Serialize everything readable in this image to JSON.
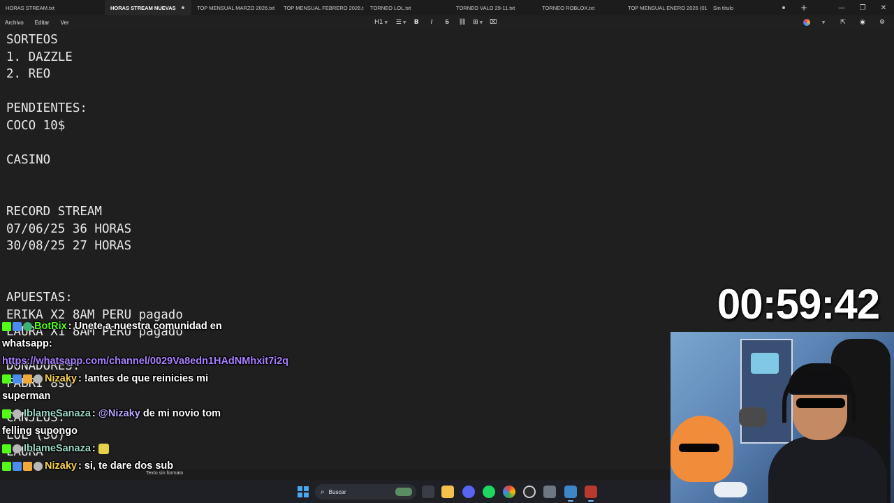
{
  "tabs": [
    {
      "label": "HORAS STREAM.txt",
      "active": false
    },
    {
      "label": "HORAS STREAM NUEVAS",
      "active": true
    },
    {
      "label": "TOP MENSUAL MARZO 2026.txt",
      "active": false
    },
    {
      "label": "TOP MENSUAL FEBRERO 2026.t",
      "active": false
    },
    {
      "label": "TORNEO LOL.txt",
      "active": false
    },
    {
      "label": "TORNEO VALO 29-11.txt",
      "active": false
    },
    {
      "label": "TORNEO ROBLOX.txt",
      "active": false
    },
    {
      "label": "TOP MENSUAL ENERO 2026 (01(",
      "active": false
    },
    {
      "label": "Sin título",
      "active": false
    }
  ],
  "menu": {
    "archivo": "Archivo",
    "editar": "Editar",
    "ver": "Ver"
  },
  "toolbar": {
    "heading": "H1",
    "list_icon": "list-icon",
    "bold": "B",
    "italic": "I",
    "strike": "S",
    "link_icon": "link-icon",
    "table_icon": "table-icon",
    "clear_icon": "clear-format-icon"
  },
  "editor_lines": [
    "SORTEOS",
    "1. DAZZLE",
    "2. REO",
    "",
    "PENDIENTES:",
    "COCO 10$",
    "",
    "CASINO",
    "",
    "",
    "RECORD STREAM",
    "07/06/25 36 HORAS",
    "30/08/25 27 HORAS",
    "",
    "",
    "APUESTAS:",
    "ERIKA X2 8AM PERU pagado",
    "LAURA X1 8AM PERU pagado",
    "",
    "DONADORES:",
    "FABRI 8so",
    "",
    "CANJEOS:",
    "LOL (SO)",
    "LAURA"
  ],
  "status": {
    "format": "Texto sin formato"
  },
  "taskbar": {
    "search_placeholder": "Buscar"
  },
  "timer": "00:59:42",
  "chat": [
    {
      "user": "BotRix",
      "user_color": "#53fc18",
      "text": ": Unete a nuestra comunidad en whatsapp: ",
      "link": "https://whatsapp.com/channel/0029Va8edn1HAdNMhxit7i2q"
    },
    {
      "user": "Nizaky",
      "user_color": "#f7d24a",
      "text": ": !antes de que reinicies mi superman"
    },
    {
      "user": "IblameSanaza",
      "user_color": "#9ad7c7",
      "text_pre": ": ",
      "mention": "@Nizaky",
      "text": " de mi novio tom felling supongo"
    },
    {
      "user": "IblameSanaza",
      "user_color": "#9ad7c7",
      "text": ": "
    },
    {
      "user": "Nizaky",
      "user_color": "#f7d24a",
      "text": ": si, te dare dos sub"
    }
  ],
  "colors": {
    "editor_bg": "#1f1f1f",
    "editor_text": "#eaeaea",
    "kick_green": "#53fc18",
    "link": "#a880ff"
  }
}
